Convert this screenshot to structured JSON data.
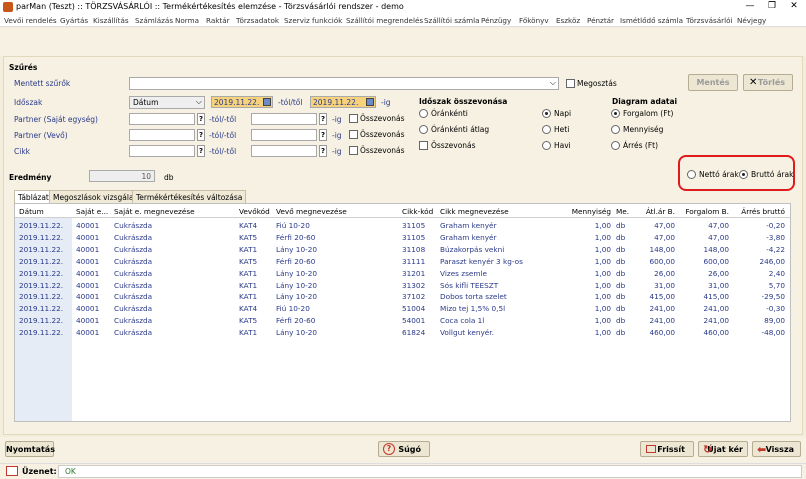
{
  "window": {
    "title": "parMan (Teszt) :: TÖRZSVÁSÁRLÓI :: Termékértékesítés elemzése  -  Törzsvásárlói rendszer - demo",
    "controls": [
      "—",
      "❐",
      "✕"
    ]
  },
  "menu": [
    "Vevői rendelés",
    "Gyártás",
    "Kiszállítás",
    "Számlázás",
    "Norma",
    "Raktár",
    "Törzsadatok",
    "Szerviz funkciók",
    "Szállítói megrendelés",
    "Szállítói számla",
    "Pénzügy",
    "Főkönyv",
    "Eszköz",
    "Pénztár",
    "Ismétlődő számla",
    "Törzsvásárlói",
    "Névjegy"
  ],
  "filter": {
    "section_title": "Szűrés",
    "saved_label": "Mentett szűrők",
    "share_label": "Megosztás",
    "save_btn": "Mentés",
    "delete_btn": "Törlés",
    "period_label": "Időszak",
    "period_type": "Dátum",
    "date_from": "2019.11.22.",
    "from_to": "-tól/től",
    "date_to": "2019.11.22.",
    "ig": "-ig",
    "partner_own_label": "Partner (Saját egység)",
    "partner_buyer_label": "Partner (Vevő)",
    "item_label": "Cikk",
    "q": "?",
    "fromto2": "-tól/-től",
    "merge_label": "Összevonás"
  },
  "period_merge": {
    "title": "Időszak összevonása",
    "hourly": "Óránkénti",
    "hourly_avg": "Óránkénti átlag",
    "merge": "Összevonás",
    "daily": "Napi",
    "weekly": "Heti",
    "monthly": "Havi"
  },
  "diagram": {
    "title": "Diagram adatai",
    "turnover": "Forgalom (Ft)",
    "quantity": "Mennyiség",
    "margin": "Árrés (Ft)"
  },
  "result": {
    "label": "Eredmény",
    "count": "10",
    "unit": "db",
    "net_prices": "Nettó árak",
    "gross_prices": "Bruttó árak"
  },
  "tabs": [
    "Táblázat",
    "Megoszlások vizsgálata",
    "Termékértékesítés változása"
  ],
  "table": {
    "headers": [
      "Dátum",
      "Saját e...",
      "Saját e. megnevezése",
      "Vevőkód",
      "Vevő megnevezése",
      "Cikk-kód",
      "Cikk megnevezése",
      "Mennyiség",
      "Me.",
      "Átl.ár B.",
      "Forgalom B.",
      "Árrés bruttó"
    ],
    "rows": [
      [
        "2019.11.22.",
        "40001",
        "Cukrászda",
        "KAT4",
        "Fiú 10-20",
        "31105",
        "Graham kenyér",
        "1,00",
        "db",
        "47,00",
        "47,00",
        "-0,20"
      ],
      [
        "2019.11.22.",
        "40001",
        "Cukrászda",
        "KAT5",
        "Férfi 20-60",
        "31105",
        "Graham kenyér",
        "1,00",
        "db",
        "47,00",
        "47,00",
        "-3,80"
      ],
      [
        "2019.11.22.",
        "40001",
        "Cukrászda",
        "KAT1",
        "Lány 10-20",
        "31108",
        "Búzakorpás vekni",
        "1,00",
        "db",
        "148,00",
        "148,00",
        "-4,22"
      ],
      [
        "2019.11.22.",
        "40001",
        "Cukrászda",
        "KAT5",
        "Férfi 20-60",
        "31111",
        "Paraszt kenyér 3 kg-os",
        "1,00",
        "db",
        "600,00",
        "600,00",
        "246,00"
      ],
      [
        "2019.11.22.",
        "40001",
        "Cukrászda",
        "KAT1",
        "Lány 10-20",
        "31201",
        "Vizes zsemle",
        "1,00",
        "db",
        "26,00",
        "26,00",
        "2,40"
      ],
      [
        "2019.11.22.",
        "40001",
        "Cukrászda",
        "KAT1",
        "Lány 10-20",
        "31302",
        "Sós kifli TEESZT",
        "1,00",
        "db",
        "31,00",
        "31,00",
        "5,70"
      ],
      [
        "2019.11.22.",
        "40001",
        "Cukrászda",
        "KAT1",
        "Lány 10-20",
        "37102",
        "Dobos torta szelet",
        "1,00",
        "db",
        "415,00",
        "415,00",
        "-29,50"
      ],
      [
        "2019.11.22.",
        "40001",
        "Cukrászda",
        "KAT4",
        "Fiú 10-20",
        "51004",
        "Mizo tej 1,5% 0,5l",
        "1,00",
        "db",
        "241,00",
        "241,00",
        "-0,30"
      ],
      [
        "2019.11.22.",
        "40001",
        "Cukrászda",
        "KAT5",
        "Férfi 20-60",
        "54001",
        "Coca cola 1l",
        "1,00",
        "db",
        "241,00",
        "241,00",
        "89,00"
      ],
      [
        "2019.11.22.",
        "40001",
        "Cukrászda",
        "KAT1",
        "Lány 10-20",
        "61824",
        "Vollgut kenyér.",
        "1,00",
        "db",
        "460,00",
        "460,00",
        "-48,00"
      ]
    ]
  },
  "bottom": {
    "print": "Nyomtatás",
    "help": "Súgó",
    "refresh": "Frissít",
    "newsearch": "Újat kér",
    "back": "Vissza"
  },
  "status": {
    "label": "Üzenet:",
    "value": "OK"
  },
  "colors": {
    "highlight_ring": "#e01b1b",
    "date_field": "#f7d27d",
    "text_blue": "#2a3a8a"
  }
}
